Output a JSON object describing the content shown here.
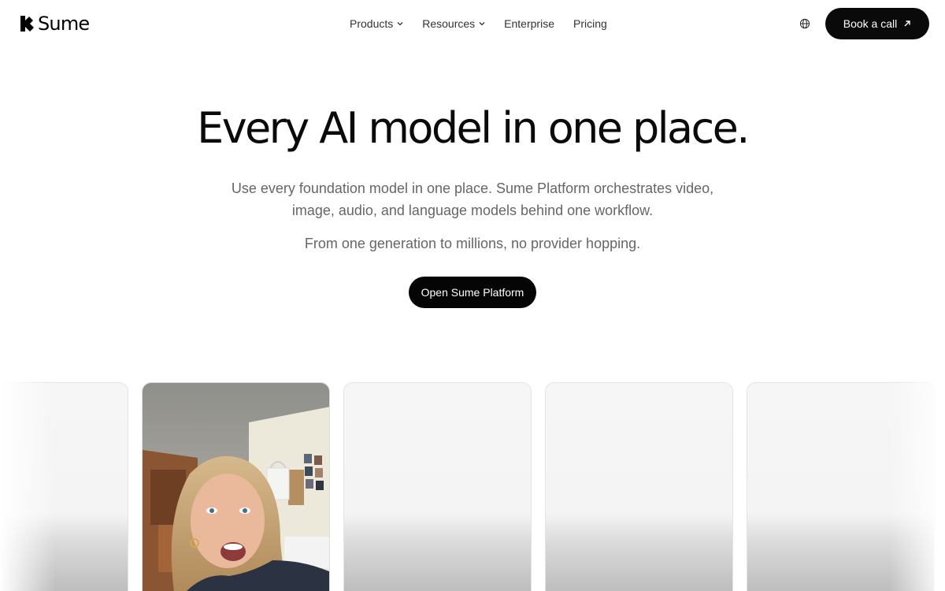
{
  "brand": {
    "name": "Sume"
  },
  "nav": {
    "items": [
      {
        "label": "Products",
        "has_dropdown": true
      },
      {
        "label": "Resources",
        "has_dropdown": true
      },
      {
        "label": "Enterprise",
        "has_dropdown": false
      },
      {
        "label": "Pricing",
        "has_dropdown": false
      }
    ],
    "language_icon": "globe-icon",
    "book_call": {
      "label": "Book a call",
      "icon": "arrow-up-right-icon"
    }
  },
  "hero": {
    "title": "Every AI model in one place.",
    "subtitle": "Use every foundation model in one place. Sume Platform orchestrates video, image, audio, and language models behind one workflow.",
    "subtitle2": "From one generation to millions, no provider hopping.",
    "cta_label": "Open Sume Platform"
  },
  "colors": {
    "primary_button": "#0a0a0a",
    "muted_text": "#666666",
    "card_bg": "#f5f5f5"
  },
  "cards": [
    {
      "kind": "placeholder"
    },
    {
      "kind": "video-thumbnail",
      "icon": "person-photo"
    },
    {
      "kind": "placeholder"
    },
    {
      "kind": "placeholder"
    },
    {
      "kind": "placeholder"
    }
  ]
}
